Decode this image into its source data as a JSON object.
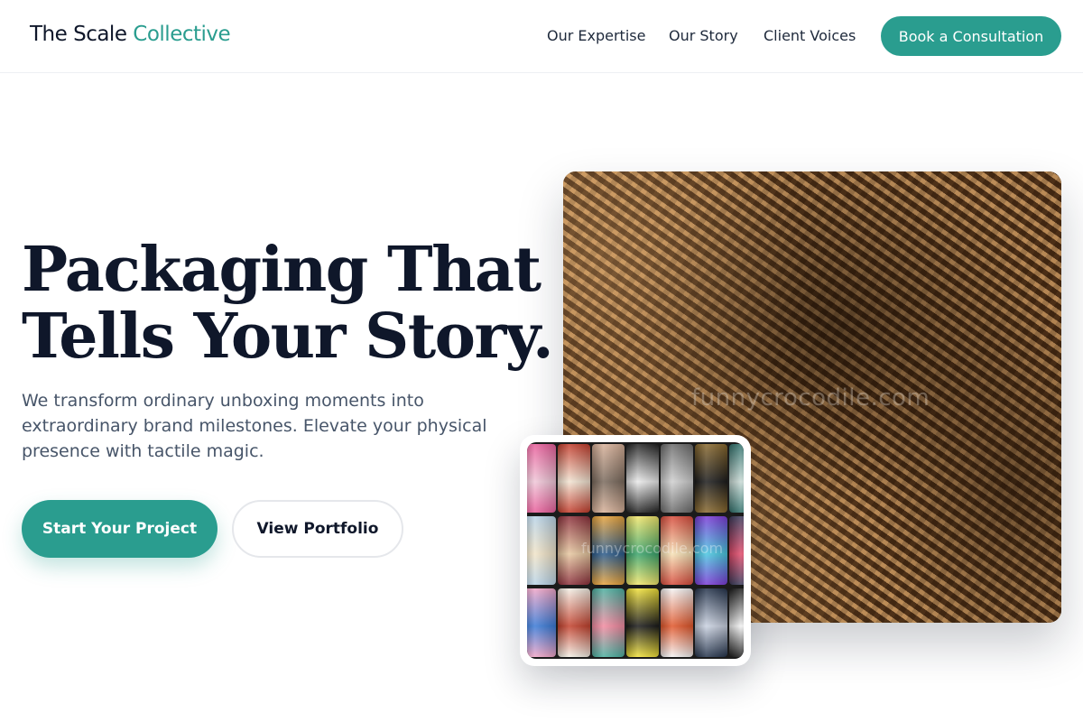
{
  "header": {
    "logo_main": "The Scale",
    "logo_accent": "Collective",
    "nav": [
      "Our Expertise",
      "Our Story",
      "Client Voices"
    ],
    "cta": "Book a Consultation"
  },
  "hero": {
    "title_line1": "Packaging That",
    "title_line2": "Tells Your Story.",
    "subtitle": "We transform ordinary unboxing moments into extraordinary brand milestones. Elevate your physical presence with tactile magic.",
    "primary_button": "Start Your Project",
    "secondary_button": "View Portfolio"
  },
  "images": {
    "main_watermark": "funnycrocodile.com",
    "cans_watermark": "funnycrocodile.com"
  },
  "colors": {
    "accent": "#2a9d8f",
    "heading": "#0f172a",
    "body_text": "#475569"
  }
}
